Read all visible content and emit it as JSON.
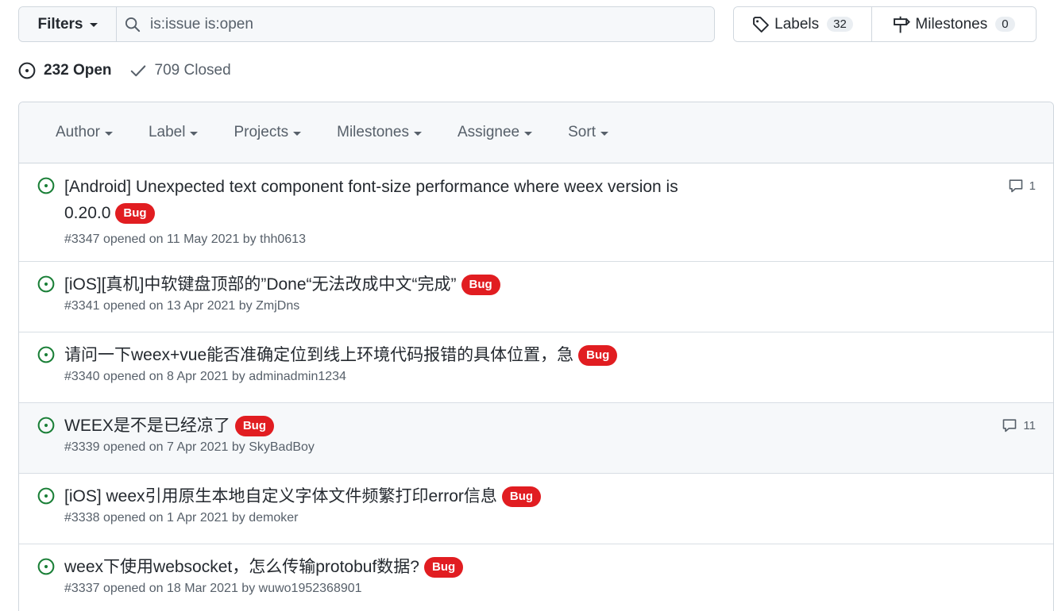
{
  "toolbar": {
    "filters_label": "Filters",
    "search_value": "is:issue is:open",
    "labels_label": "Labels",
    "labels_count": "32",
    "milestones_label": "Milestones",
    "milestones_count": "0"
  },
  "states": {
    "open_label": "232 Open",
    "closed_label": "709 Closed"
  },
  "box_header": {
    "author": "Author",
    "label": "Label",
    "projects": "Projects",
    "milestones": "Milestones",
    "assignee": "Assignee",
    "sort": "Sort"
  },
  "colors": {
    "open_icon": "#1a7f37",
    "bug_label": "#e11d21"
  },
  "issues": [
    {
      "title_line1": "[Android] Unexpected text component font-size performance where weex version is",
      "title_line2": "0.20.0",
      "label": "Bug",
      "meta": "#3347 opened on 11 May 2021 by thh0613",
      "comments": "1"
    },
    {
      "title": "[iOS][真机]中软键盘顶部的”Done“无法改成中文“完成”",
      "label": "Bug",
      "meta": "#3341 opened on 13 Apr 2021 by ZmjDns"
    },
    {
      "title": "请问一下weex+vue能否准确定位到线上环境代码报错的具体位置，急",
      "label": "Bug",
      "meta": "#3340 opened on 8 Apr 2021 by adminadmin1234"
    },
    {
      "title": "WEEX是不是已经凉了",
      "label": "Bug",
      "meta": "#3339 opened on 7 Apr 2021 by SkyBadBoy",
      "comments": "11"
    },
    {
      "title": "[iOS] weex引用原生本地自定义字体文件频繁打印error信息",
      "label": "Bug",
      "meta": "#3338 opened on 1 Apr 2021 by demoker"
    },
    {
      "title": "weex下使用websocket，怎么传输protobuf数据?",
      "label": "Bug",
      "meta": "#3337 opened on 18 Mar 2021 by wuwo1952368901"
    }
  ]
}
